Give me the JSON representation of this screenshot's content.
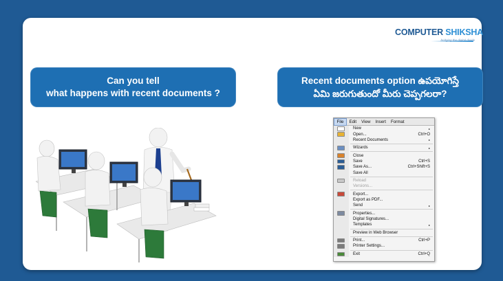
{
  "logo": {
    "brand_main": "COMPUTER",
    "brand_accent": " SHIKSHA",
    "tagline": "bridging the digital divide"
  },
  "question_english": {
    "line1": "Can you tell",
    "line2": "what happens with recent documents ?"
  },
  "question_telugu": {
    "line1": "Recent documents option ఉపయోగిస్తే",
    "line2": "ఏమి జరుగుతుందో మీరు చెప్పగలరా?"
  },
  "menu": {
    "menubar": [
      "File",
      "Edit",
      "View",
      "Insert",
      "Format"
    ],
    "items": [
      {
        "label": "New",
        "shortcut": "",
        "submenu": true,
        "disabled": false,
        "icon": "new-document-icon",
        "icon_color": "#ffffff",
        "sep_after": false
      },
      {
        "label": "Open...",
        "shortcut": "Ctrl+O",
        "submenu": false,
        "disabled": false,
        "icon": "open-folder-icon",
        "icon_color": "#e8b232",
        "sep_after": false
      },
      {
        "label": "Recent Documents",
        "shortcut": "",
        "submenu": true,
        "disabled": false,
        "icon": "",
        "icon_color": "",
        "sep_after": true
      },
      {
        "label": "Wizards",
        "shortcut": "",
        "submenu": true,
        "disabled": false,
        "icon": "wizard-icon",
        "icon_color": "#6b8fc2",
        "sep_after": true
      },
      {
        "label": "Close",
        "shortcut": "",
        "submenu": false,
        "disabled": false,
        "icon": "close-document-icon",
        "icon_color": "#d9822b",
        "sep_after": false
      },
      {
        "label": "Save",
        "shortcut": "Ctrl+S",
        "submenu": false,
        "disabled": false,
        "icon": "save-icon",
        "icon_color": "#2b5d96",
        "sep_after": false
      },
      {
        "label": "Save As...",
        "shortcut": "Ctrl+Shift+S",
        "submenu": false,
        "disabled": false,
        "icon": "save-as-icon",
        "icon_color": "#2b5d96",
        "sep_after": false
      },
      {
        "label": "Save All",
        "shortcut": "",
        "submenu": false,
        "disabled": false,
        "icon": "",
        "icon_color": "",
        "sep_after": true
      },
      {
        "label": "Reload",
        "shortcut": "",
        "submenu": false,
        "disabled": true,
        "icon": "reload-icon",
        "icon_color": "#c8c8c8",
        "sep_after": false
      },
      {
        "label": "Versions...",
        "shortcut": "",
        "submenu": false,
        "disabled": true,
        "icon": "",
        "icon_color": "",
        "sep_after": true
      },
      {
        "label": "Export...",
        "shortcut": "",
        "submenu": false,
        "disabled": false,
        "icon": "export-icon",
        "icon_color": "#c84a3a",
        "sep_after": false
      },
      {
        "label": "Export as PDF...",
        "shortcut": "",
        "submenu": false,
        "disabled": false,
        "icon": "",
        "icon_color": "",
        "sep_after": false
      },
      {
        "label": "Send",
        "shortcut": "",
        "submenu": true,
        "disabled": false,
        "icon": "",
        "icon_color": "",
        "sep_after": true
      },
      {
        "label": "Properties...",
        "shortcut": "",
        "submenu": false,
        "disabled": false,
        "icon": "properties-icon",
        "icon_color": "#7d8aa0",
        "sep_after": false
      },
      {
        "label": "Digital Signatures...",
        "shortcut": "",
        "submenu": false,
        "disabled": false,
        "icon": "",
        "icon_color": "",
        "sep_after": false
      },
      {
        "label": "Templates",
        "shortcut": "",
        "submenu": true,
        "disabled": false,
        "icon": "",
        "icon_color": "",
        "sep_after": true
      },
      {
        "label": "Preview in Web Browser",
        "shortcut": "",
        "submenu": false,
        "disabled": false,
        "icon": "",
        "icon_color": "",
        "sep_after": true
      },
      {
        "label": "Print...",
        "shortcut": "Ctrl+P",
        "submenu": false,
        "disabled": false,
        "icon": "print-icon",
        "icon_color": "#7b7b7b",
        "sep_after": false
      },
      {
        "label": "Printer Settings...",
        "shortcut": "",
        "submenu": false,
        "disabled": false,
        "icon": "printer-settings-icon",
        "icon_color": "#7b7b7b",
        "sep_after": true
      },
      {
        "label": "Exit",
        "shortcut": "Ctrl+Q",
        "submenu": false,
        "disabled": false,
        "icon": "exit-icon",
        "icon_color": "#4a8a3a",
        "sep_after": false
      }
    ]
  }
}
